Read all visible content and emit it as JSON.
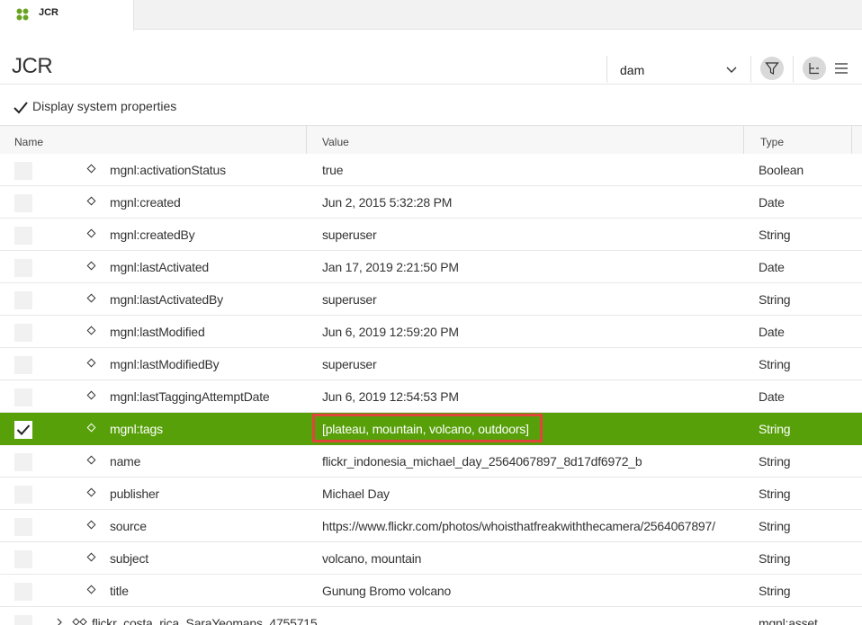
{
  "tab": {
    "label": "JCR",
    "icon": "magnolia-logo-icon"
  },
  "header": {
    "title": "JCR",
    "workspace": "dam",
    "filter_icon": "filter-icon",
    "tree_view_icon": "tree-view-icon",
    "list_view_icon": "list-view-icon"
  },
  "system_properties": {
    "label": "Display system properties",
    "checked": true
  },
  "columns": {
    "name": "Name",
    "value": "Value",
    "type": "Type"
  },
  "rows": [
    {
      "name": "mgnl:activationStatus",
      "value": "true",
      "type": "Boolean",
      "selected": false
    },
    {
      "name": "mgnl:created",
      "value": "Jun 2, 2015 5:32:28 PM",
      "type": "Date",
      "selected": false
    },
    {
      "name": "mgnl:createdBy",
      "value": "superuser",
      "type": "String",
      "selected": false
    },
    {
      "name": "mgnl:lastActivated",
      "value": "Jan 17, 2019 2:21:50 PM",
      "type": "Date",
      "selected": false
    },
    {
      "name": "mgnl:lastActivatedBy",
      "value": "superuser",
      "type": "String",
      "selected": false
    },
    {
      "name": "mgnl:lastModified",
      "value": "Jun 6, 2019 12:59:20 PM",
      "type": "Date",
      "selected": false
    },
    {
      "name": "mgnl:lastModifiedBy",
      "value": "superuser",
      "type": "String",
      "selected": false
    },
    {
      "name": "mgnl:lastTaggingAttemptDate",
      "value": "Jun 6, 2019 12:54:53 PM",
      "type": "Date",
      "selected": false
    },
    {
      "name": "mgnl:tags",
      "value": "[plateau, mountain, volcano, outdoors]",
      "type": "String",
      "selected": true
    },
    {
      "name": "name",
      "value": "flickr_indonesia_michael_day_2564067897_8d17df6972_b",
      "type": "String",
      "selected": false
    },
    {
      "name": "publisher",
      "value": "Michael Day",
      "type": "String",
      "selected": false
    },
    {
      "name": "source",
      "value": "https://www.flickr.com/photos/whoisthatfreakwiththecamera/2564067897/",
      "type": "String",
      "selected": false
    },
    {
      "name": "subject",
      "value": "volcano, mountain",
      "type": "String",
      "selected": false
    },
    {
      "name": "title",
      "value": "Gunung Bromo volcano",
      "type": "String",
      "selected": false
    }
  ],
  "partial_row": {
    "name": "flickr_costa_rica_SaraYeomans_4755715",
    "type": "mgnl:asset"
  },
  "colors": {
    "selected_row": "#57a009",
    "highlight_border": "#e0453c",
    "logo": "#6aa321"
  }
}
